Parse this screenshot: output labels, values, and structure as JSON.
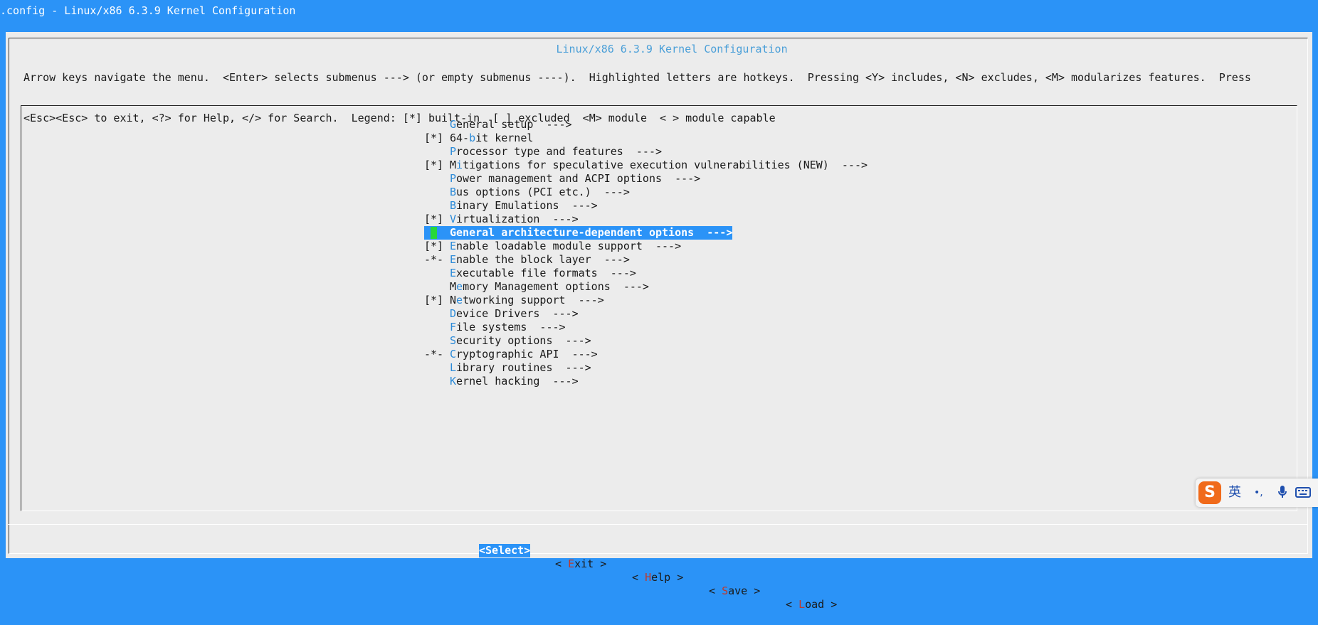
{
  "title_bar": {
    "text": ".config - Linux/x86 6.3.9 Kernel Configuration"
  },
  "dialog": {
    "title": "Linux/x86 6.3.9 Kernel Configuration",
    "help_line1": "Arrow keys navigate the menu.  <Enter> selects submenus ---> (or empty submenus ----).  Highlighted letters are hotkeys.  Pressing <Y> includes, <N> excludes, <M> modularizes features.  Press",
    "help_line2": "<Esc><Esc> to exit, <?> for Help, </> for Search.  Legend: [*] built-in  [ ] excluded  <M> module  < > module capable"
  },
  "menu": {
    "items": [
      {
        "state": "",
        "hot": "G",
        "rest": "eneral setup  --->",
        "pre": ""
      },
      {
        "state": "[*]",
        "pre": "64-",
        "hot": "b",
        "rest": "it kernel"
      },
      {
        "state": "",
        "pre": "",
        "hot": "P",
        "rest": "rocessor type and features  --->"
      },
      {
        "state": "[*]",
        "pre": "M",
        "hot": "i",
        "rest": "tigations for speculative execution vulnerabilities (NEW)  --->"
      },
      {
        "state": "",
        "pre": "",
        "hot": "P",
        "rest": "ower management and ACPI options  --->"
      },
      {
        "state": "",
        "pre": "",
        "hot": "B",
        "rest": "us options (PCI etc.)  --->"
      },
      {
        "state": "",
        "pre": "",
        "hot": "B",
        "rest": "inary Emulations  --->"
      },
      {
        "state": "[*]",
        "pre": "",
        "hot": "V",
        "rest": "irtualization  --->"
      },
      {
        "state": "",
        "pre": "",
        "hot": "G",
        "rest": "eneral architecture-dependent options  --->"
      },
      {
        "state": "[*]",
        "pre": "",
        "hot": "E",
        "rest": "nable loadable module support  --->"
      },
      {
        "state": "-*-",
        "pre": "",
        "hot": "E",
        "rest": "nable the block layer  --->"
      },
      {
        "state": "",
        "pre": "",
        "hot": "E",
        "rest": "xecutable file formats  --->"
      },
      {
        "state": "",
        "pre": "M",
        "hot": "e",
        "rest": "mory Management options  --->"
      },
      {
        "state": "[*]",
        "pre": "N",
        "hot": "e",
        "rest": "tworking support  --->"
      },
      {
        "state": "",
        "pre": "",
        "hot": "D",
        "rest": "evice Drivers  --->"
      },
      {
        "state": "",
        "pre": "",
        "hot": "F",
        "rest": "ile systems  --->"
      },
      {
        "state": "",
        "pre": "",
        "hot": "S",
        "rest": "ecurity options  --->"
      },
      {
        "state": "-*-",
        "pre": "",
        "hot": "C",
        "rest": "ryptographic API  --->"
      },
      {
        "state": "",
        "pre": "",
        "hot": "L",
        "rest": "ibrary routines  --->"
      },
      {
        "state": "",
        "pre": "",
        "hot": "K",
        "rest": "ernel hacking  --->"
      }
    ],
    "selected_index": 8
  },
  "buttons": {
    "select": "<Select>",
    "exit_pre": "< ",
    "exit_hot": "E",
    "exit_rest": "xit >",
    "help_pre": "< ",
    "help_hot": "H",
    "help_rest": "elp >",
    "save_pre": "< ",
    "save_hot": "S",
    "save_rest": "ave >",
    "load_pre": "< ",
    "load_hot": "L",
    "load_rest": "oad >"
  },
  "ime": {
    "logo": "S",
    "lang": "英",
    "punct": "•,",
    "mic_icon": "microphone-icon",
    "keyboard_icon": "keyboard-icon"
  },
  "colors": {
    "terminal_blue": "#2b93f7",
    "dialog_bg": "#ececec",
    "hotkey_blue": "#2b8ad8",
    "cursor_green": "#27d83a",
    "button_hotkey_red": "#c0392b",
    "ime_orange": "#f06a1a"
  }
}
